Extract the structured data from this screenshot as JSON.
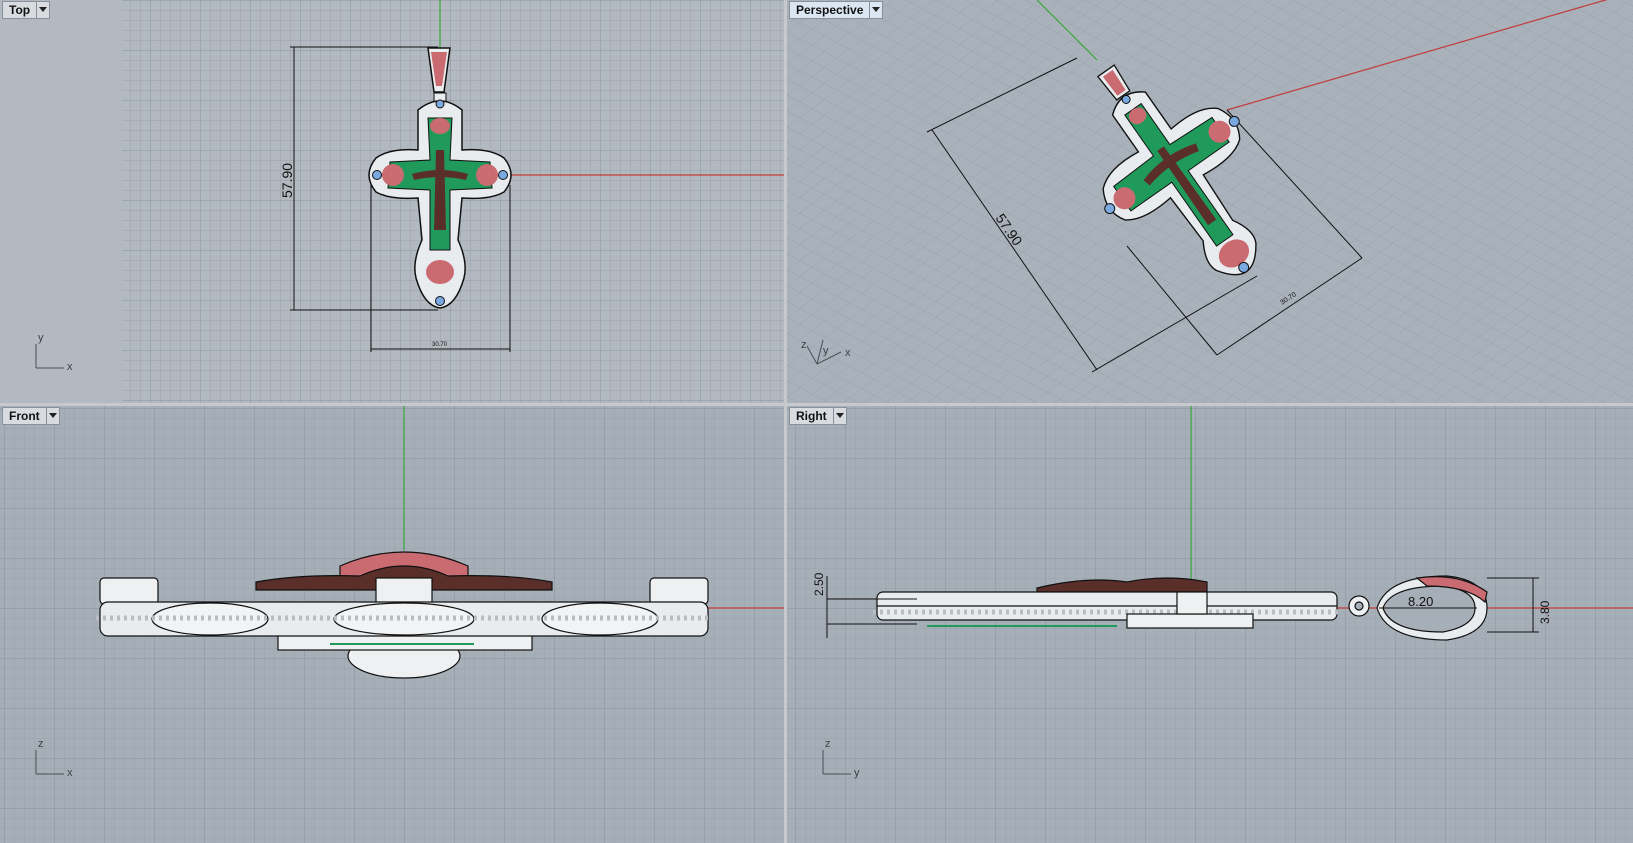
{
  "viewports": {
    "top": {
      "title": "Top",
      "dim_height": "57.90",
      "dim_width": "30.70",
      "axis_y": "y",
      "axis_x": "x"
    },
    "perspective": {
      "title": "Perspective",
      "dim_height": "57.90",
      "dim_width": "30.70",
      "axis_z": "z",
      "axis_y": "y",
      "axis_x": "x"
    },
    "front": {
      "title": "Front",
      "axis_z": "z",
      "axis_x": "x"
    },
    "right": {
      "title": "Right",
      "dim_thickness": "2.50",
      "dim_bail_length": "8.20",
      "dim_bail_height": "3.80",
      "axis_z": "z",
      "axis_y": "y"
    }
  },
  "colors": {
    "viewport_bg": "#a6aeb7",
    "grid_minor": "#9aa2ab",
    "grid_major": "#8c949d",
    "x_axis": "#c23b3b",
    "y_axis": "#3aa63a",
    "silver": "#e9ecef",
    "enamel_green": "#1f9a5a",
    "rose": "#c96b70",
    "bronze": "#5a2f2a",
    "stone_blue": "#7aa8e0"
  },
  "icons": {
    "menu": "chevron-down-icon"
  }
}
